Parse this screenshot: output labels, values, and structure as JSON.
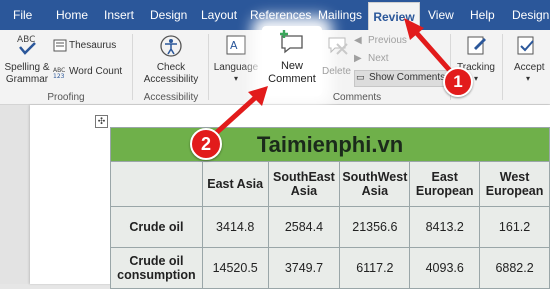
{
  "tabs": [
    "File",
    "Home",
    "Insert",
    "Design",
    "Layout",
    "References",
    "Mailings",
    "Review",
    "View",
    "Help",
    "Design"
  ],
  "active_tab": "Review",
  "ribbon": {
    "spelling_label_1": "Spelling &",
    "spelling_label_2": "Grammar",
    "thesaurus_label": "Thesaurus",
    "word_count_label": "Word Count",
    "proofing_group": "Proofing",
    "check_label_1": "Check",
    "check_label_2": "Accessibility",
    "accessibility_group": "Accessibility",
    "language_label": "Language",
    "new_comment_label_1": "New",
    "new_comment_label_2": "Comment",
    "delete_label": "Delete",
    "previous_label": "Previous",
    "next_label": "Next",
    "show_comments_label": "Show Comments",
    "comments_group": "Comments",
    "tracking_label": "Tracking",
    "accept_label": "Accept"
  },
  "annotations": {
    "badge_1": "1",
    "badge_2": "2"
  },
  "table": {
    "title": "Taimienphi.vn",
    "headers": [
      "East Asia",
      "SouthEast Asia",
      "SouthWest Asia",
      "East European",
      "West European"
    ],
    "rows": [
      {
        "label": "Crude oil",
        "values": [
          "3414.8",
          "2584.4",
          "21356.6",
          "8413.2",
          "161.2"
        ]
      },
      {
        "label": "Crude oil consumption",
        "values": [
          "14520.5",
          "3749.7",
          "6117.2",
          "4093.6",
          "6882.2"
        ]
      }
    ]
  },
  "colors": {
    "ribbon_blue": "#2b579a",
    "table_title_green": "#6fb04a",
    "arrow_red": "#e21b1b"
  }
}
